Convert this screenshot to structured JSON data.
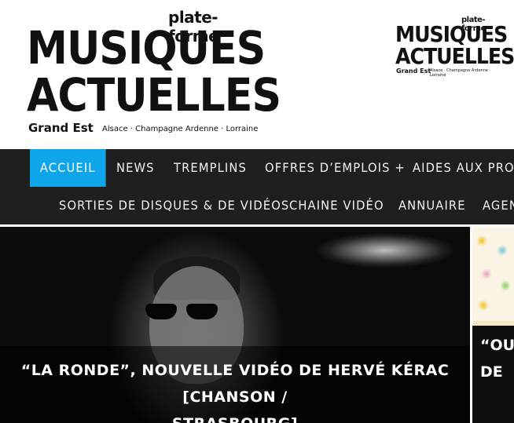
{
  "logo": {
    "plate_forme": "plate-forme",
    "line1": "MUSIQUES",
    "line2": "ACTUELLES",
    "region": "Grand Est",
    "subregion": "Alsace · Champagne Ardenne · Lorraine"
  },
  "nav": {
    "row1": [
      "ACCUEIL",
      "NEWS",
      "TREMPLINS",
      "OFFRES D’EMPLOIS +",
      "AIDES AUX PROJE"
    ],
    "row2": [
      "SORTIES DE DISQUES & DE VIDÉOS",
      "CHAINE VIDÉO",
      "ANNUAIRE",
      "AGEN"
    ],
    "active": "ACCUEIL"
  },
  "featured": {
    "title_line1": "“LA RONDE”, NOUVELLE VIDÉO DE HERVÉ KÉRAC [CHANSON /",
    "title_line2": "STRASBOURG]"
  },
  "side": {
    "line1": "“OUR",
    "line2": "DE"
  },
  "colors": {
    "accent": "#0ea5ea",
    "nav_bg": "#1f1f1f",
    "header_bg": "#ffffff"
  }
}
